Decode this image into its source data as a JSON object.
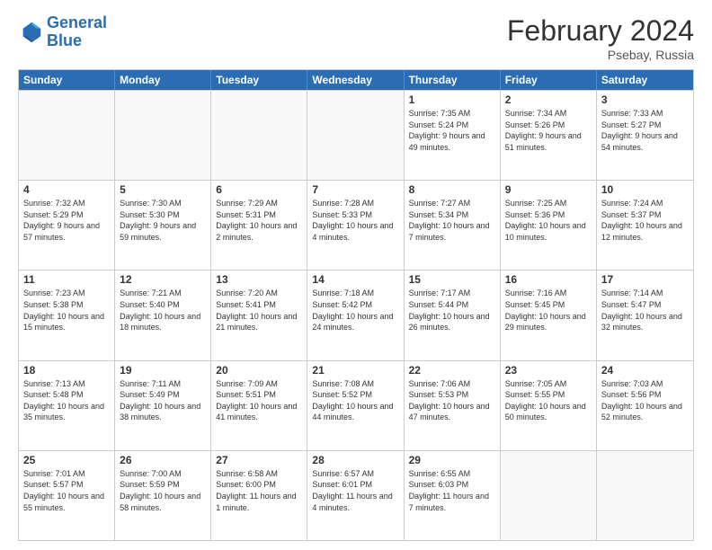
{
  "logo": {
    "line1": "General",
    "line2": "Blue"
  },
  "title": "February 2024",
  "location": "Psebay, Russia",
  "header": {
    "days": [
      "Sunday",
      "Monday",
      "Tuesday",
      "Wednesday",
      "Thursday",
      "Friday",
      "Saturday"
    ]
  },
  "rows": [
    [
      {
        "day": "",
        "empty": true
      },
      {
        "day": "",
        "empty": true
      },
      {
        "day": "",
        "empty": true
      },
      {
        "day": "",
        "empty": true
      },
      {
        "day": "1",
        "sunrise": "7:35 AM",
        "sunset": "5:24 PM",
        "daylight": "9 hours and 49 minutes."
      },
      {
        "day": "2",
        "sunrise": "7:34 AM",
        "sunset": "5:26 PM",
        "daylight": "9 hours and 51 minutes."
      },
      {
        "day": "3",
        "sunrise": "7:33 AM",
        "sunset": "5:27 PM",
        "daylight": "9 hours and 54 minutes."
      }
    ],
    [
      {
        "day": "4",
        "sunrise": "7:32 AM",
        "sunset": "5:29 PM",
        "daylight": "9 hours and 57 minutes."
      },
      {
        "day": "5",
        "sunrise": "7:30 AM",
        "sunset": "5:30 PM",
        "daylight": "9 hours and 59 minutes."
      },
      {
        "day": "6",
        "sunrise": "7:29 AM",
        "sunset": "5:31 PM",
        "daylight": "10 hours and 2 minutes."
      },
      {
        "day": "7",
        "sunrise": "7:28 AM",
        "sunset": "5:33 PM",
        "daylight": "10 hours and 4 minutes."
      },
      {
        "day": "8",
        "sunrise": "7:27 AM",
        "sunset": "5:34 PM",
        "daylight": "10 hours and 7 minutes."
      },
      {
        "day": "9",
        "sunrise": "7:25 AM",
        "sunset": "5:36 PM",
        "daylight": "10 hours and 10 minutes."
      },
      {
        "day": "10",
        "sunrise": "7:24 AM",
        "sunset": "5:37 PM",
        "daylight": "10 hours and 12 minutes."
      }
    ],
    [
      {
        "day": "11",
        "sunrise": "7:23 AM",
        "sunset": "5:38 PM",
        "daylight": "10 hours and 15 minutes."
      },
      {
        "day": "12",
        "sunrise": "7:21 AM",
        "sunset": "5:40 PM",
        "daylight": "10 hours and 18 minutes."
      },
      {
        "day": "13",
        "sunrise": "7:20 AM",
        "sunset": "5:41 PM",
        "daylight": "10 hours and 21 minutes."
      },
      {
        "day": "14",
        "sunrise": "7:18 AM",
        "sunset": "5:42 PM",
        "daylight": "10 hours and 24 minutes."
      },
      {
        "day": "15",
        "sunrise": "7:17 AM",
        "sunset": "5:44 PM",
        "daylight": "10 hours and 26 minutes."
      },
      {
        "day": "16",
        "sunrise": "7:16 AM",
        "sunset": "5:45 PM",
        "daylight": "10 hours and 29 minutes."
      },
      {
        "day": "17",
        "sunrise": "7:14 AM",
        "sunset": "5:47 PM",
        "daylight": "10 hours and 32 minutes."
      }
    ],
    [
      {
        "day": "18",
        "sunrise": "7:13 AM",
        "sunset": "5:48 PM",
        "daylight": "10 hours and 35 minutes."
      },
      {
        "day": "19",
        "sunrise": "7:11 AM",
        "sunset": "5:49 PM",
        "daylight": "10 hours and 38 minutes."
      },
      {
        "day": "20",
        "sunrise": "7:09 AM",
        "sunset": "5:51 PM",
        "daylight": "10 hours and 41 minutes."
      },
      {
        "day": "21",
        "sunrise": "7:08 AM",
        "sunset": "5:52 PM",
        "daylight": "10 hours and 44 minutes."
      },
      {
        "day": "22",
        "sunrise": "7:06 AM",
        "sunset": "5:53 PM",
        "daylight": "10 hours and 47 minutes."
      },
      {
        "day": "23",
        "sunrise": "7:05 AM",
        "sunset": "5:55 PM",
        "daylight": "10 hours and 50 minutes."
      },
      {
        "day": "24",
        "sunrise": "7:03 AM",
        "sunset": "5:56 PM",
        "daylight": "10 hours and 52 minutes."
      }
    ],
    [
      {
        "day": "25",
        "sunrise": "7:01 AM",
        "sunset": "5:57 PM",
        "daylight": "10 hours and 55 minutes."
      },
      {
        "day": "26",
        "sunrise": "7:00 AM",
        "sunset": "5:59 PM",
        "daylight": "10 hours and 58 minutes."
      },
      {
        "day": "27",
        "sunrise": "6:58 AM",
        "sunset": "6:00 PM",
        "daylight": "11 hours and 1 minute."
      },
      {
        "day": "28",
        "sunrise": "6:57 AM",
        "sunset": "6:01 PM",
        "daylight": "11 hours and 4 minutes."
      },
      {
        "day": "29",
        "sunrise": "6:55 AM",
        "sunset": "6:03 PM",
        "daylight": "11 hours and 7 minutes."
      },
      {
        "day": "",
        "empty": true
      },
      {
        "day": "",
        "empty": true
      }
    ]
  ]
}
